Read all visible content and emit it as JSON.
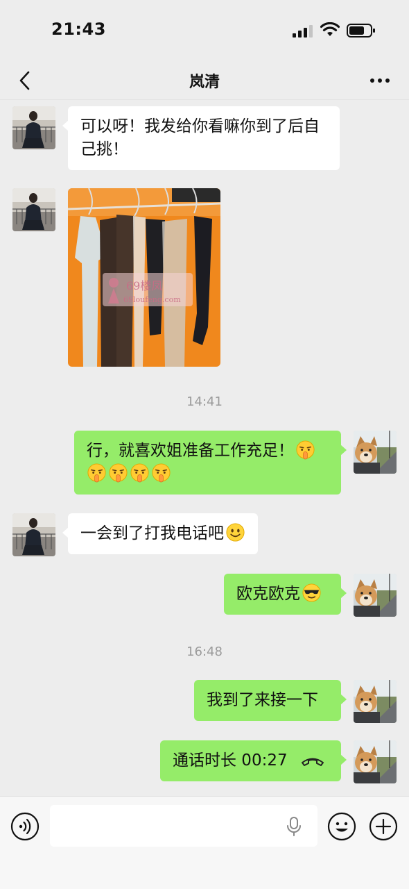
{
  "status_bar": {
    "time": "21:43"
  },
  "header": {
    "title": "岚清"
  },
  "messages": [
    {
      "text": "可以呀！我发给你看嘛你到了后自己挑！"
    },
    {
      "watermark_brand": "69楼凤",
      "watermark_url": "69loufeng.com"
    },
    {
      "time": "14:41"
    },
    {
      "text": "行，就喜欢姐准备工作充足！"
    },
    {
      "text": "一会到了打我电话吧"
    },
    {
      "text": "欧克欧克"
    },
    {
      "time": "16:48"
    },
    {
      "text": "我到了来接一下"
    },
    {
      "text": "通话时长 00:27"
    }
  ],
  "input_bar": {
    "placeholder": ""
  },
  "colors": {
    "outgoing_bubble": "#95ec69",
    "incoming_bubble": "#ffffff",
    "background": "#ededed"
  },
  "icons": [
    "back-icon",
    "more-icon",
    "signal-icon",
    "wifi-icon",
    "battery-icon",
    "voice-icon",
    "mic-icon",
    "emoji-icon",
    "plus-icon",
    "call-end-icon"
  ]
}
